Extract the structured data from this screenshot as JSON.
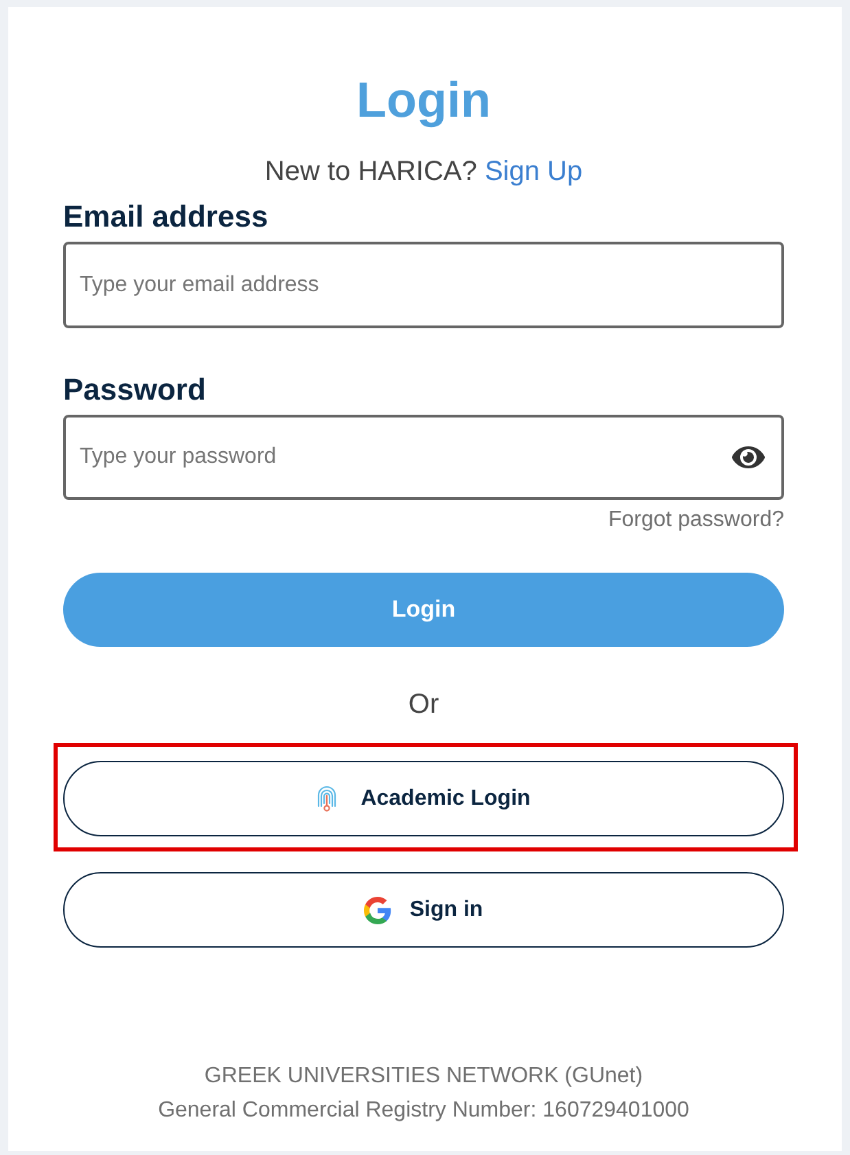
{
  "title": "Login",
  "signup_prompt": {
    "text": "New to HARICA?",
    "link": "Sign Up"
  },
  "fields": [
    {
      "kind": "email",
      "label": "Email address",
      "placeholder": "Type your email address"
    },
    {
      "kind": "password",
      "label": "Password",
      "placeholder": "Type your password"
    }
  ],
  "forgot_link": "Forgot password?",
  "login_button": "Login",
  "separator": "Or",
  "alt_logins": [
    {
      "kind": "academic",
      "label": "Academic Login",
      "highlighted": true
    },
    {
      "kind": "google",
      "label": "Sign in",
      "highlighted": false
    }
  ],
  "footer": [
    "GREEK UNIVERSITIES NETWORK (GUnet)",
    "General Commercial Registry Number: 160729401000"
  ]
}
